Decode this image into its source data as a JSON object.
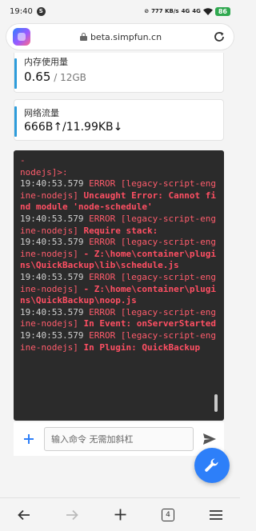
{
  "status_bar": {
    "time": "19:40",
    "notification_badge": "S",
    "network_speed": "777 KB/s",
    "signal_a": "4G",
    "signal_b": "4G",
    "battery": "86"
  },
  "browser": {
    "url": "beta.simpfun.cn"
  },
  "memory_card": {
    "title": "内存使用量",
    "value": "0.65",
    "total": " / 12GB"
  },
  "network_card": {
    "title": "网络流量",
    "value": "666B↑/11.99KB↓"
  },
  "console": {
    "lines": [
      {
        "ts": "",
        "level": "",
        "msg": "-"
      },
      {
        "ts": "",
        "level": "",
        "msg": "nodejs]>:"
      },
      {
        "ts": "19:40:53.579",
        "level": " ERROR [legacy-script-engine-nodejs]",
        "msg": " Uncaught Error: Cannot find module 'node-schedule'"
      },
      {
        "ts": "19:40:53.579",
        "level": " ERROR [legacy-script-engine-nodejs]",
        "msg": " Require stack:"
      },
      {
        "ts": "19:40:53.579",
        "level": " ERROR [legacy-script-engine-nodejs]",
        "msg": " - Z:\\home\\container\\plugins\\QuickBackup\\lib\\schedule.js"
      },
      {
        "ts": "19:40:53.579",
        "level": " ERROR [legacy-script-engine-nodejs]",
        "msg": " - Z:\\home\\container\\plugins\\QuickBackup\\noop.js"
      },
      {
        "ts": "19:40:53.579",
        "level": " ERROR [legacy-script-engine-nodejs]",
        "msg": " In Event: onServerStarted"
      },
      {
        "ts": "19:40:53.579",
        "level": " ERROR [legacy-script-engine-nodejs]",
        "msg": " In Plugin: QuickBackup"
      }
    ]
  },
  "command": {
    "placeholder": "输入命令 无需加斜杠",
    "value": ""
  },
  "bottom_nav": {
    "tab_count": "4"
  },
  "icons": {
    "add": "plus-icon",
    "send": "send-icon",
    "fab": "wrench-icon",
    "back": "arrow-left-icon",
    "forward": "arrow-right-icon",
    "new_tab": "plus-icon",
    "menu": "hamburger-icon"
  },
  "colors": {
    "accent": "#2d7ff9",
    "card_bar": "#2d9cdb",
    "console_bg": "#2b2b2b",
    "error_text": "#ff4f63"
  }
}
